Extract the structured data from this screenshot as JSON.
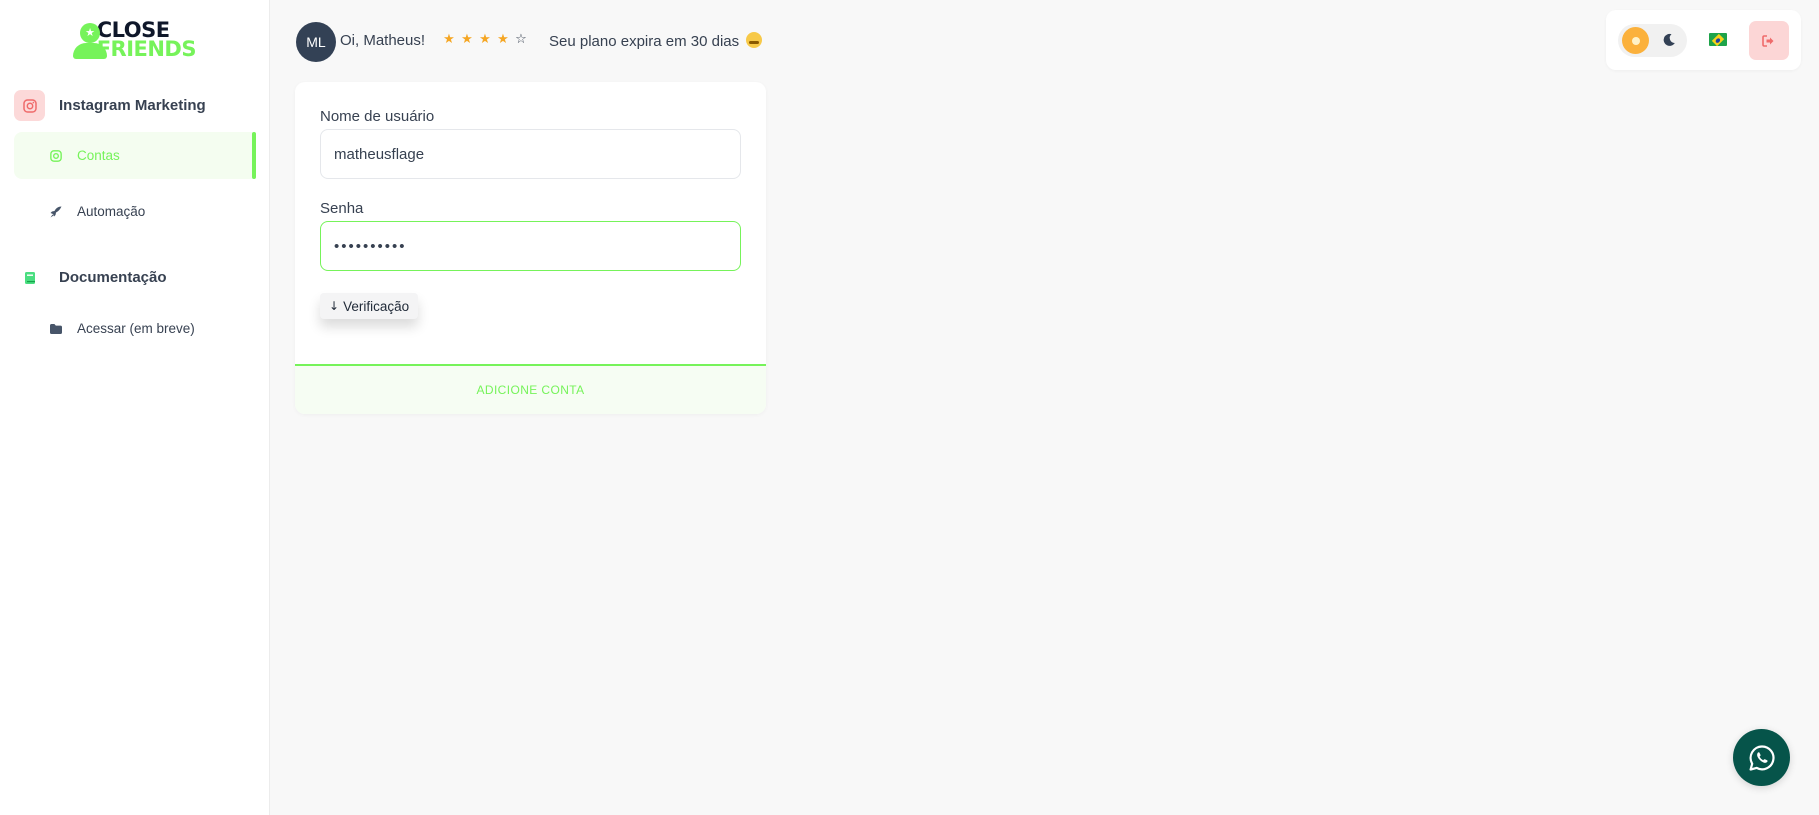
{
  "brand": {
    "line1": "CLOSE",
    "line2": "FRIENDS",
    "color": "#76f35a"
  },
  "sidebar": {
    "sections": [
      {
        "label": "Instagram Marketing",
        "icon": "instagram-icon",
        "items": [
          {
            "label": "Contas",
            "icon": "instagram-icon",
            "active": true
          },
          {
            "label": "Automação",
            "icon": "rocket-icon",
            "active": false
          }
        ]
      },
      {
        "label": "Documentação",
        "icon": "book-icon",
        "items": [
          {
            "label": "Acessar (em breve)",
            "icon": "folder-icon",
            "active": false
          }
        ]
      }
    ]
  },
  "header": {
    "avatar_initials": "ML",
    "greeting": "Oi, Matheus!",
    "rating": {
      "value": 4,
      "max": 5
    },
    "plan_text": "Seu plano expira em 30 dias",
    "plan_emoji": "grinning-face-icon"
  },
  "toolbar": {
    "theme": "light",
    "language_flag": "brazil-flag-icon",
    "logout_icon": "logout-icon"
  },
  "form": {
    "username_label": "Nome de usuário",
    "username_value": "matheusflage",
    "password_label": "Senha",
    "password_value": "••••••••••",
    "verify_label": "Verificação",
    "submit_label": "ADICIONE CONTA"
  },
  "colors": {
    "accent": "#76f35a",
    "sun": "#fbb13c",
    "whatsapp": "#06544a",
    "danger_bg": "#fcd6d6"
  }
}
